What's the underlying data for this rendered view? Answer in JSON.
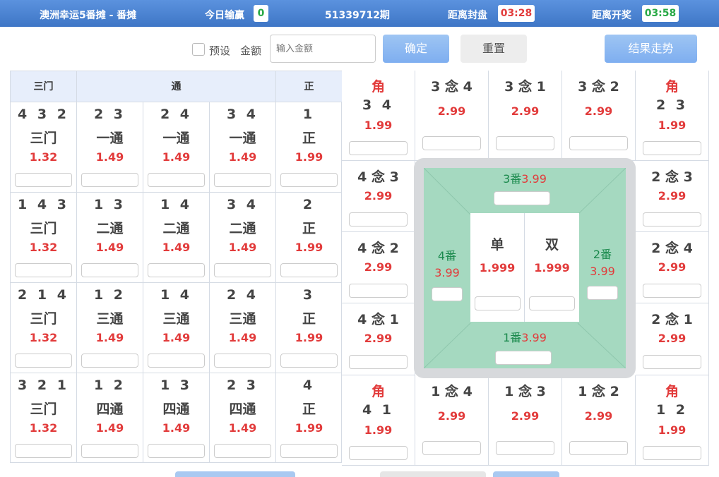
{
  "header": {
    "title": "澳洲幸运5番摊 - 番摊",
    "today_label": "今日输赢",
    "today_value": "0",
    "period": "51339712期",
    "close_label": "距离封盘",
    "close_time": "03:28",
    "open_label": "距离开奖",
    "open_time": "03:58"
  },
  "controls": {
    "preset_label": "预设",
    "amount_label": "金额",
    "amount_placeholder": "输入金额",
    "confirm_label": "确定",
    "reset_label": "重置",
    "trend_label": "结果走势"
  },
  "left_table": {
    "headers": [
      "三门",
      "通",
      "正"
    ],
    "rows": [
      [
        {
          "nums": "4 3 2",
          "name": "三门",
          "odds": "1.32"
        },
        {
          "nums": "2 3",
          "name": "一通",
          "odds": "1.49"
        },
        {
          "nums": "2 4",
          "name": "一通",
          "odds": "1.49"
        },
        {
          "nums": "3 4",
          "name": "一通",
          "odds": "1.49"
        },
        {
          "nums": "1",
          "name": "正",
          "odds": "1.99"
        }
      ],
      [
        {
          "nums": "1 4 3",
          "name": "三门",
          "odds": "1.32"
        },
        {
          "nums": "1 3",
          "name": "二通",
          "odds": "1.49"
        },
        {
          "nums": "1 4",
          "name": "二通",
          "odds": "1.49"
        },
        {
          "nums": "3 4",
          "name": "二通",
          "odds": "1.49"
        },
        {
          "nums": "2",
          "name": "正",
          "odds": "1.99"
        }
      ],
      [
        {
          "nums": "2 1 4",
          "name": "三门",
          "odds": "1.32"
        },
        {
          "nums": "1 2",
          "name": "三通",
          "odds": "1.49"
        },
        {
          "nums": "1 4",
          "name": "三通",
          "odds": "1.49"
        },
        {
          "nums": "2 4",
          "name": "三通",
          "odds": "1.49"
        },
        {
          "nums": "3",
          "name": "正",
          "odds": "1.99"
        }
      ],
      [
        {
          "nums": "3 2 1",
          "name": "三门",
          "odds": "1.32"
        },
        {
          "nums": "1 2",
          "name": "四通",
          "odds": "1.49"
        },
        {
          "nums": "1 3",
          "name": "四通",
          "odds": "1.49"
        },
        {
          "nums": "2 3",
          "name": "四通",
          "odds": "1.49"
        },
        {
          "nums": "4",
          "name": "正",
          "odds": "1.99"
        }
      ]
    ]
  },
  "board": {
    "top_row": [
      {
        "l1": "角",
        "l2": "3 4",
        "odds": "1.99"
      },
      {
        "l1": "3 念 4",
        "odds": "2.99"
      },
      {
        "l1": "3 念 1",
        "odds": "2.99"
      },
      {
        "l1": "3 念 2",
        "odds": "2.99"
      },
      {
        "l1": "角",
        "l2": "2 3",
        "odds": "1.99"
      }
    ],
    "bottom_row": [
      {
        "l1": "角",
        "l2": "4 1",
        "odds": "1.99"
      },
      {
        "l1": "1 念 4",
        "odds": "2.99"
      },
      {
        "l1": "1 念 3",
        "odds": "2.99"
      },
      {
        "l1": "1 念 2",
        "odds": "2.99"
      },
      {
        "l1": "角",
        "l2": "1 2",
        "odds": "1.99"
      }
    ],
    "left_col": [
      {
        "l1": "4 念 3",
        "odds": "2.99"
      },
      {
        "l1": "4 念 2",
        "odds": "2.99"
      },
      {
        "l1": "4 念 1",
        "odds": "2.99"
      }
    ],
    "right_col": [
      {
        "l1": "2 念 3",
        "odds": "2.99"
      },
      {
        "l1": "2 念 4",
        "odds": "2.99"
      },
      {
        "l1": "2 念 1",
        "odds": "2.99"
      }
    ],
    "fan3": {
      "label": "3番",
      "odds": "3.99"
    },
    "fan1": {
      "label": "1番",
      "odds": "3.99"
    },
    "fan4": {
      "label": "4番",
      "odds": "3.99"
    },
    "fan2": {
      "label": "2番",
      "odds": "3.99"
    },
    "dan": {
      "label": "单",
      "odds": "1.999"
    },
    "shuang": {
      "label": "双",
      "odds": "1.999"
    }
  }
}
